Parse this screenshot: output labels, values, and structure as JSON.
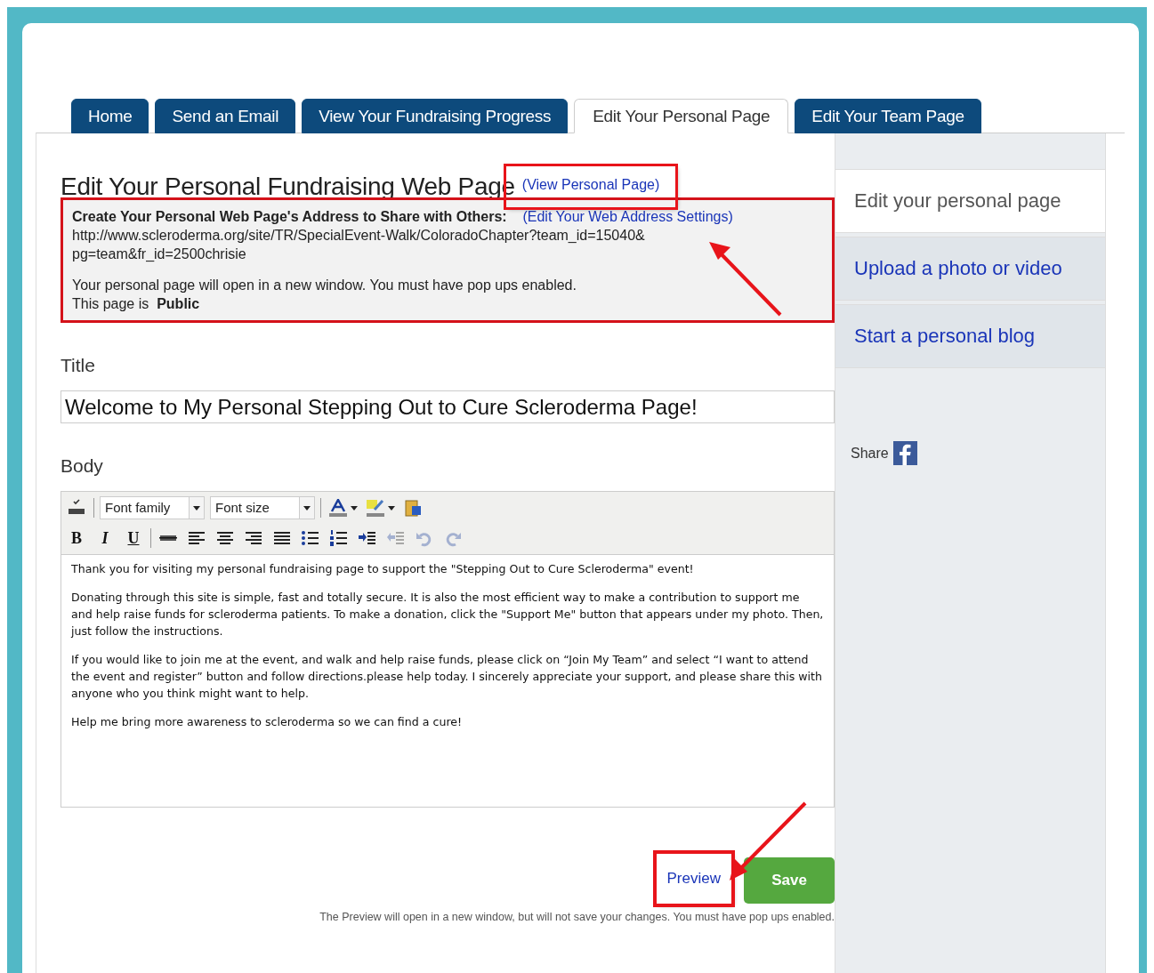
{
  "tabs": [
    {
      "label": "Home",
      "selected": false
    },
    {
      "label": "Send an Email",
      "selected": false
    },
    {
      "label": "View Your Fundraising Progress",
      "selected": false
    },
    {
      "label": "Edit Your Personal Page",
      "selected": true
    },
    {
      "label": "Edit Your Team Page",
      "selected": false
    }
  ],
  "heading": "Edit Your Personal Fundraising Web Page",
  "view_link": {
    "label": "(View Personal Page)",
    "annotated": true
  },
  "address_box": {
    "annotated": true,
    "label": "Create Your Personal Web Page's Address to Share with Others:",
    "edit_link": "(Edit Your Web Address Settings)",
    "url_lines": [
      "http://www.scleroderma.org/site/TR/SpecialEvent-Walk/ColoradoChapter?team_id=15040&",
      "pg=team&fr_id=2500chrisie"
    ],
    "note": "Your personal page will open in a new window. You must have pop ups enabled.",
    "visibility": "This page is  **Public**"
  },
  "title_label": "Title",
  "title_value": "Welcome to My Personal Stepping Out to Cure Scleroderma Page!",
  "body_label": "Body",
  "toolbar": {
    "row1": [
      {
        "kind": "spellcheck",
        "disabled": false
      },
      {
        "kind": "select",
        "label": "Font family"
      },
      {
        "kind": "select",
        "label": "Font size"
      },
      {
        "kind": "textcolor",
        "disabled": false
      },
      {
        "kind": "highlight",
        "disabled": false
      },
      {
        "kind": "pasteword",
        "disabled": false
      }
    ],
    "row2": [
      {
        "kind": "bold",
        "label": "B",
        "disabled": false
      },
      {
        "kind": "italic",
        "label": "I",
        "disabled": false
      },
      {
        "kind": "underline",
        "label": "U",
        "disabled": false
      },
      {
        "kind": "strike",
        "disabled": false
      },
      {
        "kind": "alignleft",
        "disabled": false
      },
      {
        "kind": "aligncenter",
        "disabled": false
      },
      {
        "kind": "alignright",
        "disabled": false
      },
      {
        "kind": "justify",
        "disabled": false
      },
      {
        "kind": "bullets",
        "disabled": false
      },
      {
        "kind": "numbers",
        "disabled": false
      },
      {
        "kind": "indent",
        "disabled": false
      },
      {
        "kind": "outdent",
        "disabled": true
      },
      {
        "kind": "undo",
        "disabled": true
      },
      {
        "kind": "redo",
        "disabled": true
      }
    ]
  },
  "body_paragraphs": [
    "Thank you for visiting my personal fundraising page to support the \"Stepping Out to Cure Scleroderma\" event!",
    "Donating through this site is simple, fast and totally secure. It is also the most efficient way to make a contribution to support me and help raise funds for scleroderma patients. To make a donation, click the \"Support Me\" button that appears under my photo. Then, just follow the instructions.",
    "If you would like to join me at the event, and walk and help raise funds, please click on “Join My Team” and select “I want to attend the event and register” button and follow directions.please help today. I sincerely appreciate your support, and please share this with anyone who you think might want to help.",
    "Help me bring more awareness to scleroderma so we can find a cure!"
  ],
  "preview": {
    "label": "Preview",
    "annotated": true
  },
  "save": "Save",
  "footnote": "The Preview will open in a new window, but will not save your changes. You must have pop ups enabled.",
  "sidebar": {
    "items": [
      {
        "label": "Edit your personal page",
        "selected": true
      },
      {
        "label": "Upload a photo or video",
        "selected": false
      },
      {
        "label": "Start a personal blog",
        "selected": false
      }
    ],
    "share_label": "Share"
  }
}
